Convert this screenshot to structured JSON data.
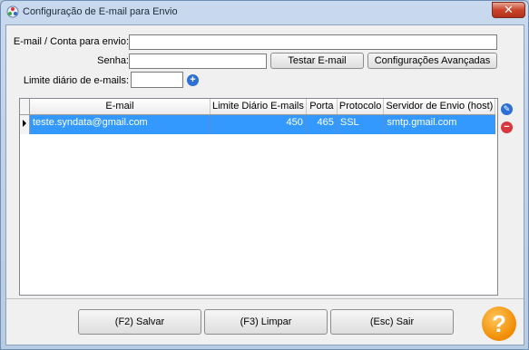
{
  "window": {
    "title": "Configuração de E-mail para Envio",
    "close_glyph": "✕"
  },
  "form": {
    "email_label": "E-mail / Conta para envio:",
    "email_value": "",
    "password_label": "Senha:",
    "password_value": "",
    "test_button": "Testar E-mail",
    "advanced_button": "Configurações Avançadas",
    "limit_label": "Limite diário de e-mails:",
    "limit_value": "",
    "add_icon_glyph": "+"
  },
  "grid": {
    "columns": [
      "E-mail",
      "Limite Diário E-mails",
      "Porta",
      "Protocolo",
      "Servidor de Envio (host)"
    ],
    "rows": [
      {
        "email": "teste.syndata@gmail.com",
        "limit": "450",
        "port": "465",
        "protocol": "SSL",
        "host": "smtp.gmail.com"
      }
    ],
    "edit_icon_glyph": "✎",
    "remove_icon_glyph": "−"
  },
  "footer": {
    "save_button": "(F2) Salvar",
    "clear_button": "(F3) Limpar",
    "exit_button": "(Esc) Sair",
    "help_glyph": "?"
  },
  "colors": {
    "selection": "#3399ff",
    "add_icon": "#2e6fd6",
    "remove_icon": "#d9363e",
    "help": "#f08a00"
  }
}
